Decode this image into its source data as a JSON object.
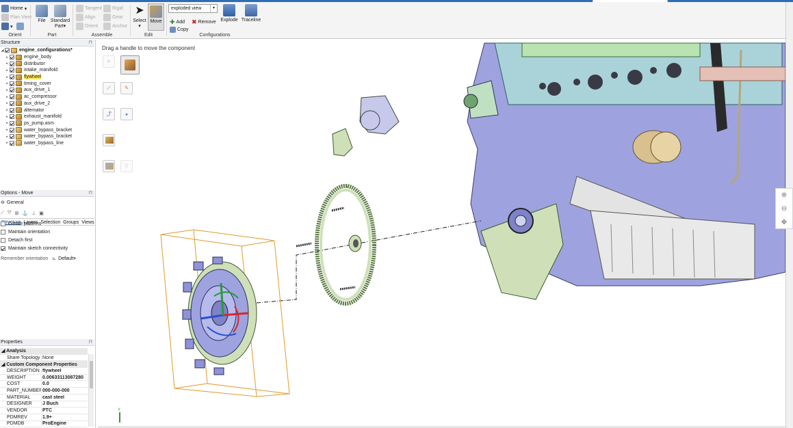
{
  "ribbon": {
    "orient": {
      "label": "Orient",
      "home": "Home",
      "plan_view": "Plan View"
    },
    "part": {
      "label": "Part",
      "file": "File",
      "standard": "Standard",
      "part": "Part"
    },
    "assemble": {
      "label": "Assemble",
      "tangent": "Tangent",
      "align": "Align",
      "orient": "Orient",
      "rigid": "Rigid",
      "gear": "Gear",
      "anchor": "Anchor"
    },
    "edit": {
      "label": "Edit",
      "select": "Select",
      "move": "Move"
    },
    "configurations": {
      "label": "Configurations",
      "combo_value": "exploded view",
      "add": "Add",
      "remove": "Remove",
      "copy": "Copy",
      "explode": "Explode",
      "traceline": "Traceline"
    }
  },
  "structure": {
    "title": "Structure",
    "root": "engine_configurations*",
    "items": [
      "engine_body",
      "distributor",
      "intake_manifold",
      "flywheel",
      "timing_cover",
      "aux_drive_1",
      "ac_compressor",
      "aux_drive_2",
      "alternator",
      "exhaust_manifold",
      "ps_pump.asm",
      "water_bypass_bracket",
      "water_bypass_bracket",
      "water_bypass_line"
    ],
    "highlighted_index": 3,
    "tabs": [
      "Structure",
      "Layers",
      "Selection",
      "Groups",
      "Views"
    ]
  },
  "options": {
    "title": "Options - Move",
    "general": "General",
    "create_patterns": "Create patterns",
    "maintain_orientation": "Maintain orientation",
    "detach_first": "Detach first",
    "maintain_sketch": "Maintain sketch connectivity",
    "remember_orientation": "Remember orientation",
    "default": "Default"
  },
  "properties": {
    "title": "Properties",
    "analysis": "Analysis",
    "share_topology_key": "Share Topology",
    "share_topology_val": "None",
    "custom": "Custom Component Properties",
    "rows": [
      {
        "k": "DESCRIPTION",
        "v": "flywheel"
      },
      {
        "k": "WEIGHT",
        "v": "0.00633113087280"
      },
      {
        "k": "COST",
        "v": "0.0"
      },
      {
        "k": "PART_NUMBER",
        "v": "000-000-000"
      },
      {
        "k": "MATERIAL",
        "v": "cast steel"
      },
      {
        "k": "DESIGNER",
        "v": "J Buch"
      },
      {
        "k": "VENDOR",
        "v": "PTC"
      },
      {
        "k": "PDMREV",
        "v": "1.9+"
      },
      {
        "k": "PDMDB",
        "v": "ProEngine"
      }
    ]
  },
  "viewport": {
    "hint": "Drag a handle to move the component",
    "axis_label": "Y"
  },
  "colors": {
    "accent": "#2f6db3",
    "highlight": "#ffe45c",
    "engine_blue": "#9a9ee0",
    "flywheel_green": "#cfe0b9",
    "bbox": "#e09a2a"
  }
}
